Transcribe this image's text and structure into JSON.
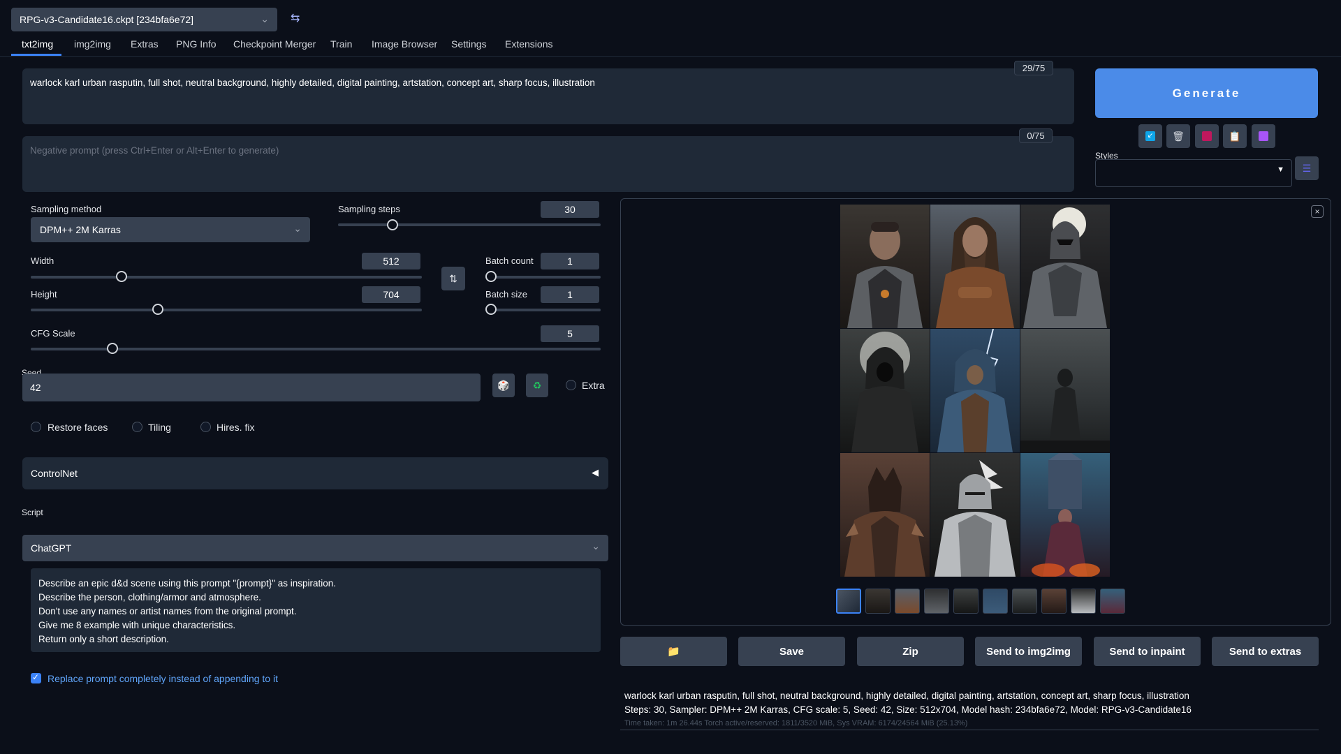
{
  "checkpoint": {
    "value": "RPG-v3-Candidate16.ckpt [234bfa6e72]"
  },
  "tabs": [
    "txt2img",
    "img2img",
    "Extras",
    "PNG Info",
    "Checkpoint Merger",
    "Train",
    "Image Browser",
    "Settings",
    "Extensions"
  ],
  "prompt": {
    "value": "warlock karl urban rasputin, full shot, neutral background, highly detailed, digital painting, artstation, concept art, sharp focus, illustration",
    "counter": "29/75"
  },
  "negative_prompt": {
    "placeholder": "Negative prompt (press Ctrl+Enter or Alt+Enter to generate)",
    "counter": "0/75"
  },
  "generate_label": "Generate",
  "styles_label": "Styles",
  "sampling_method": {
    "label": "Sampling method",
    "value": "DPM++ 2M Karras"
  },
  "sampling_steps": {
    "label": "Sampling steps",
    "value": "30"
  },
  "width": {
    "label": "Width",
    "value": "512"
  },
  "height": {
    "label": "Height",
    "value": "704"
  },
  "batch_count": {
    "label": "Batch count",
    "value": "1"
  },
  "batch_size": {
    "label": "Batch size",
    "value": "1"
  },
  "cfg_scale": {
    "label": "CFG Scale",
    "value": "5"
  },
  "seed": {
    "label": "Seed",
    "value": "42"
  },
  "extra_label": "Extra",
  "options": {
    "restore_faces": "Restore faces",
    "tiling": "Tiling",
    "hires_fix": "Hires. fix"
  },
  "controlnet_label": "ControlNet",
  "script": {
    "label": "Script",
    "value": "ChatGPT",
    "text_lines": [
      "Describe an epic d&d scene using this prompt \"{prompt}\" as inspiration.",
      "Describe the person, clothing/armor and atmosphere.",
      "Don't use any names or artist names from the original prompt.",
      "Give me 8 example with unique characteristics.",
      "Return only a short description."
    ],
    "replace_label": "Replace prompt completely instead of appending to it"
  },
  "output_buttons": {
    "folder": "folder-icon",
    "save": "Save",
    "zip": "Zip",
    "img2img": "Send to img2img",
    "inpaint": "Send to inpaint",
    "extras": "Send to extras"
  },
  "info": {
    "line1": "warlock karl urban rasputin, full shot, neutral background, highly detailed, digital painting, artstation, concept art, sharp focus, illustration",
    "line2": "Steps: 30, Sampler: DPM++ 2M Karras, CFG scale: 5, Seed: 42, Size: 512x704, Model hash: 234bfa6e72, Model: RPG-v3-Candidate16",
    "line3": "Time taken: 1m 26.44s  Torch active/reserved: 1811/3520 MiB, Sys VRAM: 6174/24564 MiB (25.13%)"
  },
  "colors": {
    "accent": "#3b82f6",
    "background": "#0b0f19",
    "panel": "#1f2937"
  }
}
